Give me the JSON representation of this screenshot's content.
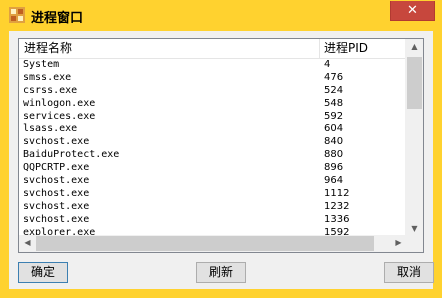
{
  "window": {
    "title": "进程窗口",
    "close_glyph": "✕"
  },
  "table": {
    "columns": [
      "进程名称",
      "进程PID"
    ],
    "rows": [
      {
        "name": "System",
        "pid": "4"
      },
      {
        "name": "smss.exe",
        "pid": "476"
      },
      {
        "name": "csrss.exe",
        "pid": "524"
      },
      {
        "name": "winlogon.exe",
        "pid": "548"
      },
      {
        "name": "services.exe",
        "pid": "592"
      },
      {
        "name": "lsass.exe",
        "pid": "604"
      },
      {
        "name": "svchost.exe",
        "pid": "840"
      },
      {
        "name": "BaiduProtect.exe",
        "pid": "880"
      },
      {
        "name": "QQPCRTP.exe",
        "pid": "896"
      },
      {
        "name": "svchost.exe",
        "pid": "964"
      },
      {
        "name": "svchost.exe",
        "pid": "1112"
      },
      {
        "name": "svchost.exe",
        "pid": "1232"
      },
      {
        "name": "svchost.exe",
        "pid": "1336"
      },
      {
        "name": "explorer.exe",
        "pid": "1592"
      }
    ]
  },
  "buttons": {
    "ok": "确定",
    "refresh": "刷新",
    "cancel": "取消"
  },
  "colors": {
    "titlebar": "#ffd22f",
    "close": "#c7473d"
  }
}
